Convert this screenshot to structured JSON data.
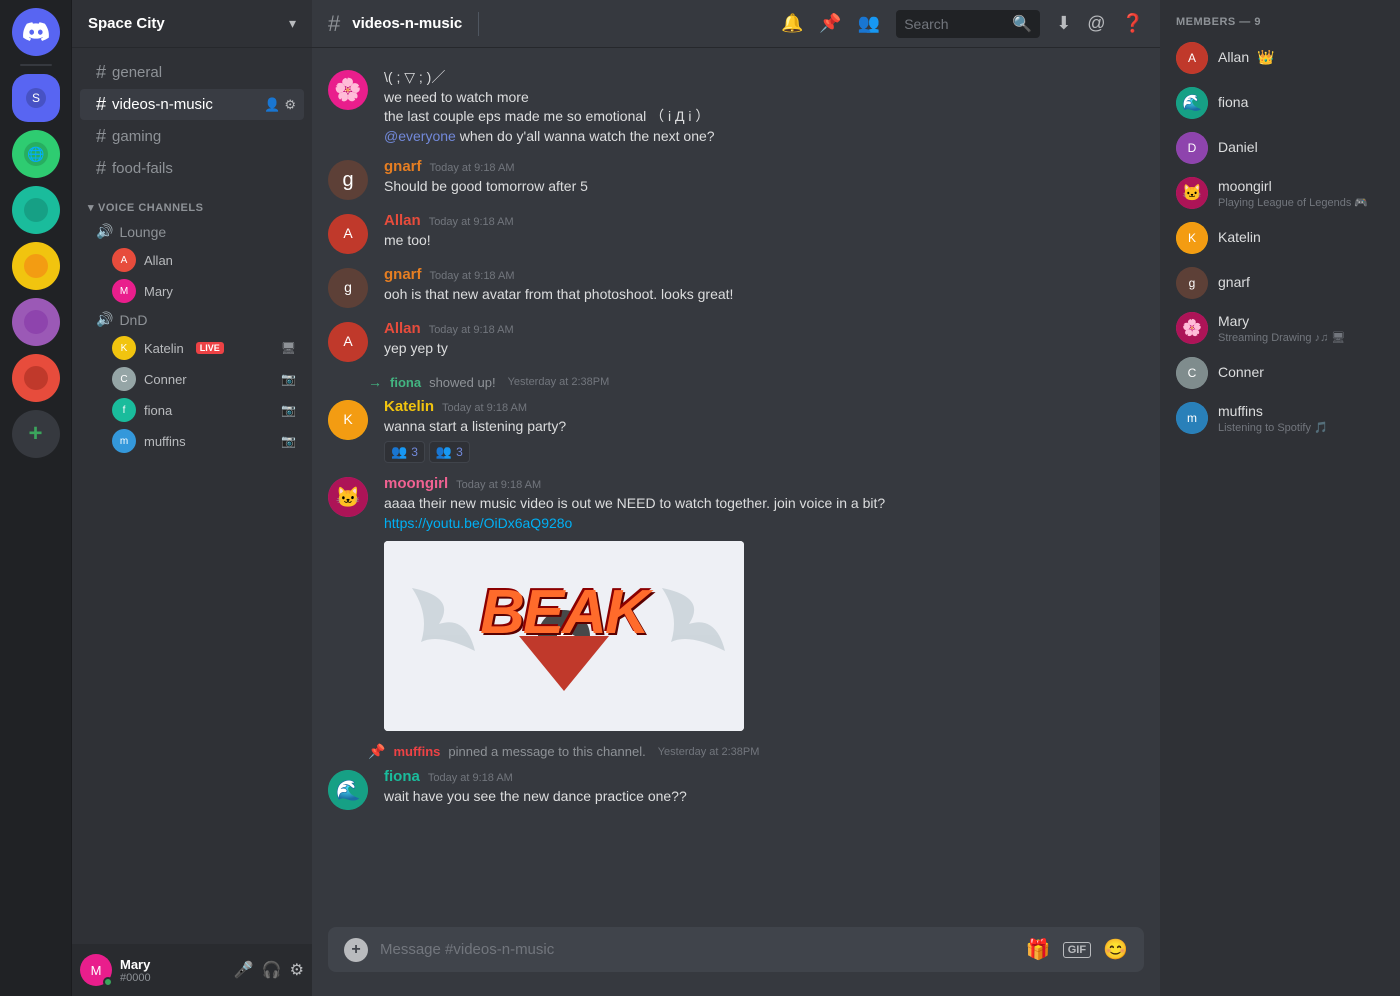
{
  "app": {
    "title": "DISCORD"
  },
  "server": {
    "name": "Space City",
    "channels": [
      {
        "id": "general",
        "name": "general",
        "type": "text"
      },
      {
        "id": "videos-n-music",
        "name": "videos-n-music",
        "type": "text",
        "active": true
      },
      {
        "id": "gaming",
        "name": "gaming",
        "type": "text"
      },
      {
        "id": "food-fails",
        "name": "food-fails",
        "type": "text"
      }
    ],
    "voice_channels": [
      {
        "name": "Lounge",
        "users": [
          {
            "name": "Allan",
            "avatar": "av-allan"
          },
          {
            "name": "Mary",
            "avatar": "av-mary",
            "live": false
          }
        ]
      },
      {
        "name": "DnD",
        "users": [
          {
            "name": "Katelin",
            "avatar": "av-katelin",
            "live": true
          },
          {
            "name": "Conner",
            "avatar": "av-conner"
          },
          {
            "name": "fiona",
            "avatar": "av-fiona"
          },
          {
            "name": "muffins",
            "avatar": "av-muffins"
          }
        ]
      }
    ]
  },
  "header": {
    "channel": "videos-n-music",
    "search_placeholder": "Search"
  },
  "messages": [
    {
      "id": "msg1",
      "author": "",
      "avatar": "av-mary",
      "color": "#f47fff",
      "continued": true,
      "lines": [
        "\\( ; ▽ ; )／",
        "we need to watch more",
        "the last couple eps made me so emotional （ i Д i ）"
      ],
      "mention_line": "@everyone when do y'all wanna watch the next one?"
    },
    {
      "id": "msg2",
      "author": "gnarf",
      "avatar": "av-gnarf",
      "color": "#e67e22",
      "timestamp": "Today at 9:18 AM",
      "text": "Should be good tomorrow after 5"
    },
    {
      "id": "msg3",
      "author": "Allan",
      "avatar": "av-allan",
      "color": "#e74c3c",
      "timestamp": "Today at 9:18 AM",
      "text": "me too!"
    },
    {
      "id": "msg4",
      "author": "gnarf",
      "avatar": "av-gnarf",
      "color": "#e67e22",
      "timestamp": "Today at 9:18 AM",
      "text": "ooh is that new avatar from that photoshoot. looks great!"
    },
    {
      "id": "msg5",
      "author": "Allan",
      "avatar": "av-allan",
      "color": "#e74c3c",
      "timestamp": "Today at 9:18 AM",
      "text": "yep yep ty"
    },
    {
      "id": "sys1",
      "type": "system",
      "user": "fiona",
      "action": "showed up!",
      "timestamp": "Yesterday at 2:38PM"
    },
    {
      "id": "msg6",
      "author": "Katelin",
      "avatar": "av-katelin",
      "color": "#f1c40f",
      "timestamp": "Today at 9:18 AM",
      "text": "wanna start a listening party?",
      "reactions": [
        {
          "emoji": "👥",
          "count": "3"
        },
        {
          "emoji": "👥",
          "count": "3"
        }
      ]
    },
    {
      "id": "msg7",
      "author": "moongirl",
      "avatar": "av-moongirl",
      "color": "#e91e8c",
      "timestamp": "Today at 9:18 AM",
      "text": "aaaa their new music video is out we NEED to watch together. join voice in a bit?",
      "link": "https://youtu.be/OiDx6aQ928o",
      "has_video": true,
      "video_title": "BEAK"
    },
    {
      "id": "sys2",
      "type": "pinned",
      "user": "muffins",
      "action": "pinned a message to this channel.",
      "timestamp": "Yesterday at 2:38PM"
    },
    {
      "id": "msg8",
      "author": "fiona",
      "avatar": "av-fiona",
      "color": "#1abc9c",
      "timestamp": "Today at 9:18 AM",
      "text": "wait have you see the new dance practice one??"
    }
  ],
  "members": {
    "header": "MEMBERS — 9",
    "list": [
      {
        "name": "Allan",
        "avatar": "av-allan",
        "crown": true,
        "online": true
      },
      {
        "name": "fiona",
        "avatar": "av-fiona",
        "online": true
      },
      {
        "name": "Daniel",
        "avatar": "av-daniel",
        "online": true
      },
      {
        "name": "moongirl",
        "avatar": "av-moongirl",
        "online": true,
        "status": "Playing League of Legends",
        "has_status_icon": true
      },
      {
        "name": "Katelin",
        "avatar": "av-katelin",
        "online": true
      },
      {
        "name": "gnarf",
        "avatar": "av-gnarf",
        "online": true
      },
      {
        "name": "Mary",
        "avatar": "av-mary",
        "online": true,
        "status": "Streaming Drawing ♪♫",
        "has_status_icon": true
      },
      {
        "name": "Conner",
        "avatar": "av-conner",
        "online": true
      },
      {
        "name": "muffins",
        "avatar": "av-muffins",
        "online": true,
        "status": "Listening to Spotify",
        "has_status_icon": true
      }
    ]
  },
  "footer": {
    "username": "Mary",
    "discriminator": "#0000"
  },
  "input": {
    "placeholder": "Message #videos-n-music"
  }
}
